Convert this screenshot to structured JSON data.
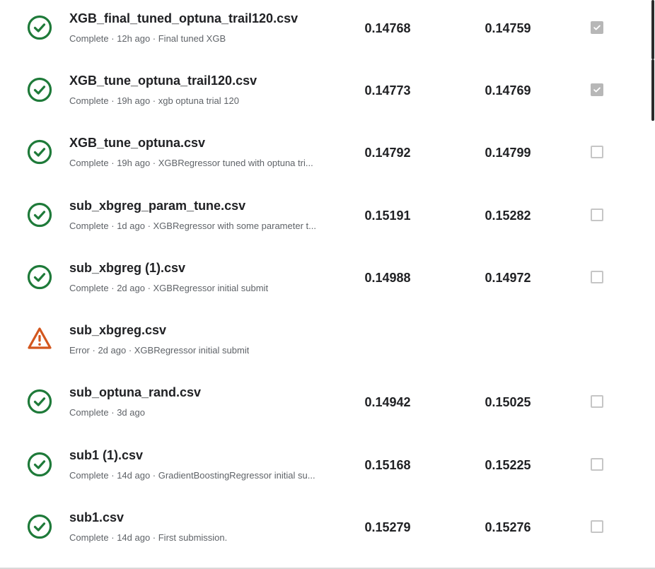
{
  "colors": {
    "success": "#1e7a39",
    "error": "#d3561d",
    "checked_box": "#b7b7b7",
    "unchecked_box": "#c6c6c6"
  },
  "submissions": [
    {
      "file_name": "XGB_final_tuned_optuna_trail120.csv",
      "meta": "Complete · 12h ago · Final tuned XGB",
      "private_score": "0.14768",
      "public_score": "0.14759",
      "status": "complete",
      "status_icon": "check-circle-icon",
      "selected": true
    },
    {
      "file_name": "XGB_tune_optuna_trail120.csv",
      "meta": "Complete · 19h ago · xgb optuna trial 120",
      "private_score": "0.14773",
      "public_score": "0.14769",
      "status": "complete",
      "status_icon": "check-circle-icon",
      "selected": true
    },
    {
      "file_name": "XGB_tune_optuna.csv",
      "meta": "Complete · 19h ago · XGBRegressor tuned with optuna tri...",
      "private_score": "0.14792",
      "public_score": "0.14799",
      "status": "complete",
      "status_icon": "check-circle-icon",
      "selected": false
    },
    {
      "file_name": "sub_xbgreg_param_tune.csv",
      "meta": "Complete · 1d ago · XGBRegressor with some parameter t...",
      "private_score": "0.15191",
      "public_score": "0.15282",
      "status": "complete",
      "status_icon": "check-circle-icon",
      "selected": false
    },
    {
      "file_name": "sub_xbgreg (1).csv",
      "meta": "Complete · 2d ago · XGBRegressor initial submit",
      "private_score": "0.14988",
      "public_score": "0.14972",
      "status": "complete",
      "status_icon": "check-circle-icon",
      "selected": false
    },
    {
      "file_name": "sub_xbgreg.csv",
      "meta": "Error · 2d ago · XGBRegressor initial submit",
      "private_score": "",
      "public_score": "",
      "status": "error",
      "status_icon": "warning-triangle-icon",
      "selected": null
    },
    {
      "file_name": "sub_optuna_rand.csv",
      "meta": "Complete · 3d ago",
      "private_score": "0.14942",
      "public_score": "0.15025",
      "status": "complete",
      "status_icon": "check-circle-icon",
      "selected": false
    },
    {
      "file_name": "sub1 (1).csv",
      "meta": "Complete · 14d ago · GradientBoostingRegressor initial su...",
      "private_score": "0.15168",
      "public_score": "0.15225",
      "status": "complete",
      "status_icon": "check-circle-icon",
      "selected": false
    },
    {
      "file_name": "sub1.csv",
      "meta": "Complete · 14d ago · First submission.",
      "private_score": "0.15279",
      "public_score": "0.15276",
      "status": "complete",
      "status_icon": "check-circle-icon",
      "selected": false
    }
  ]
}
